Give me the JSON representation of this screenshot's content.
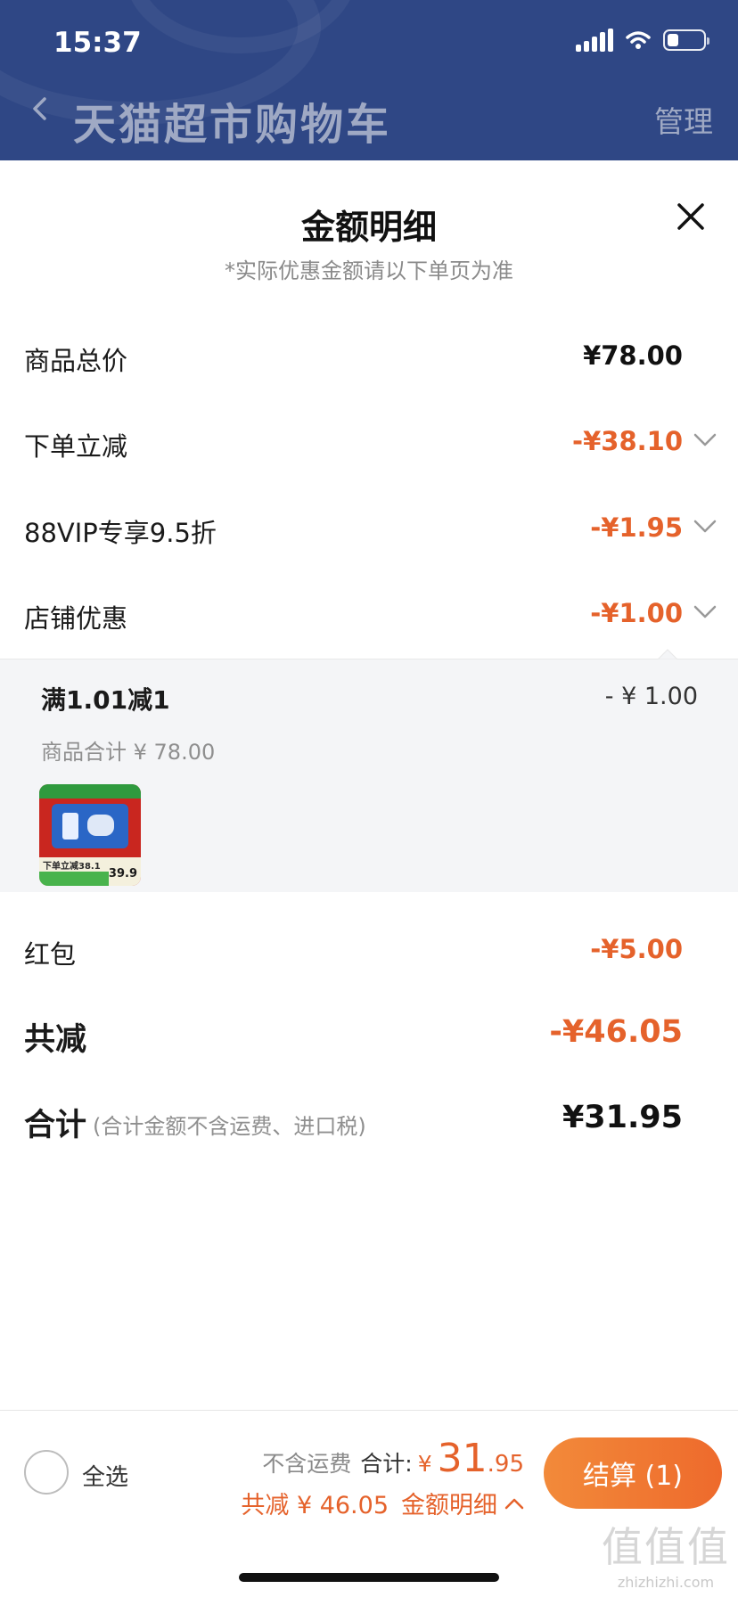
{
  "status_bar": {
    "time": "15:37"
  },
  "nav": {
    "title": "天猫超市购物车",
    "manage": "管理"
  },
  "sheet": {
    "title": "金额明细",
    "subtitle": "*实际优惠金额请以下单页为准"
  },
  "rows": [
    {
      "label": "商品总价",
      "value": "¥78.00"
    },
    {
      "label": "下单立减",
      "value": "-¥38.10"
    },
    {
      "label": "88VIP专享9.5折",
      "value": "-¥1.95"
    },
    {
      "label": "店铺优惠",
      "value": "-¥1.00"
    }
  ],
  "store_detail": {
    "title": "满1.01减1",
    "value": "- ¥ 1.00",
    "subtotal": "商品合计 ¥ 78.00",
    "thumb_promo": "下单立减38.1",
    "thumb_price": "39.9"
  },
  "red_packet": {
    "label": "红包",
    "value": "-¥5.00"
  },
  "total_discount": {
    "label": "共减",
    "value": "-¥46.05"
  },
  "total": {
    "label": "合计",
    "note": "(合计金额不含运费、进口税)",
    "value": "¥31.95"
  },
  "bottom_bar": {
    "select_all": "全选",
    "shipping_note": "不含运费",
    "sum_label": "合计:",
    "currency": "¥",
    "sum_int": "31",
    "sum_dec": ".95",
    "discount_text": "共减 ¥ 46.05",
    "detail_link": "金额明细",
    "checkout": "结算 (1)"
  },
  "watermark": {
    "logo_text": "值值值",
    "site": "zhizhizhi.com"
  },
  "colors": {
    "header_bg": "#2f4785",
    "accent_orange": "#e5622b",
    "panel_bg": "#f4f5f7"
  }
}
